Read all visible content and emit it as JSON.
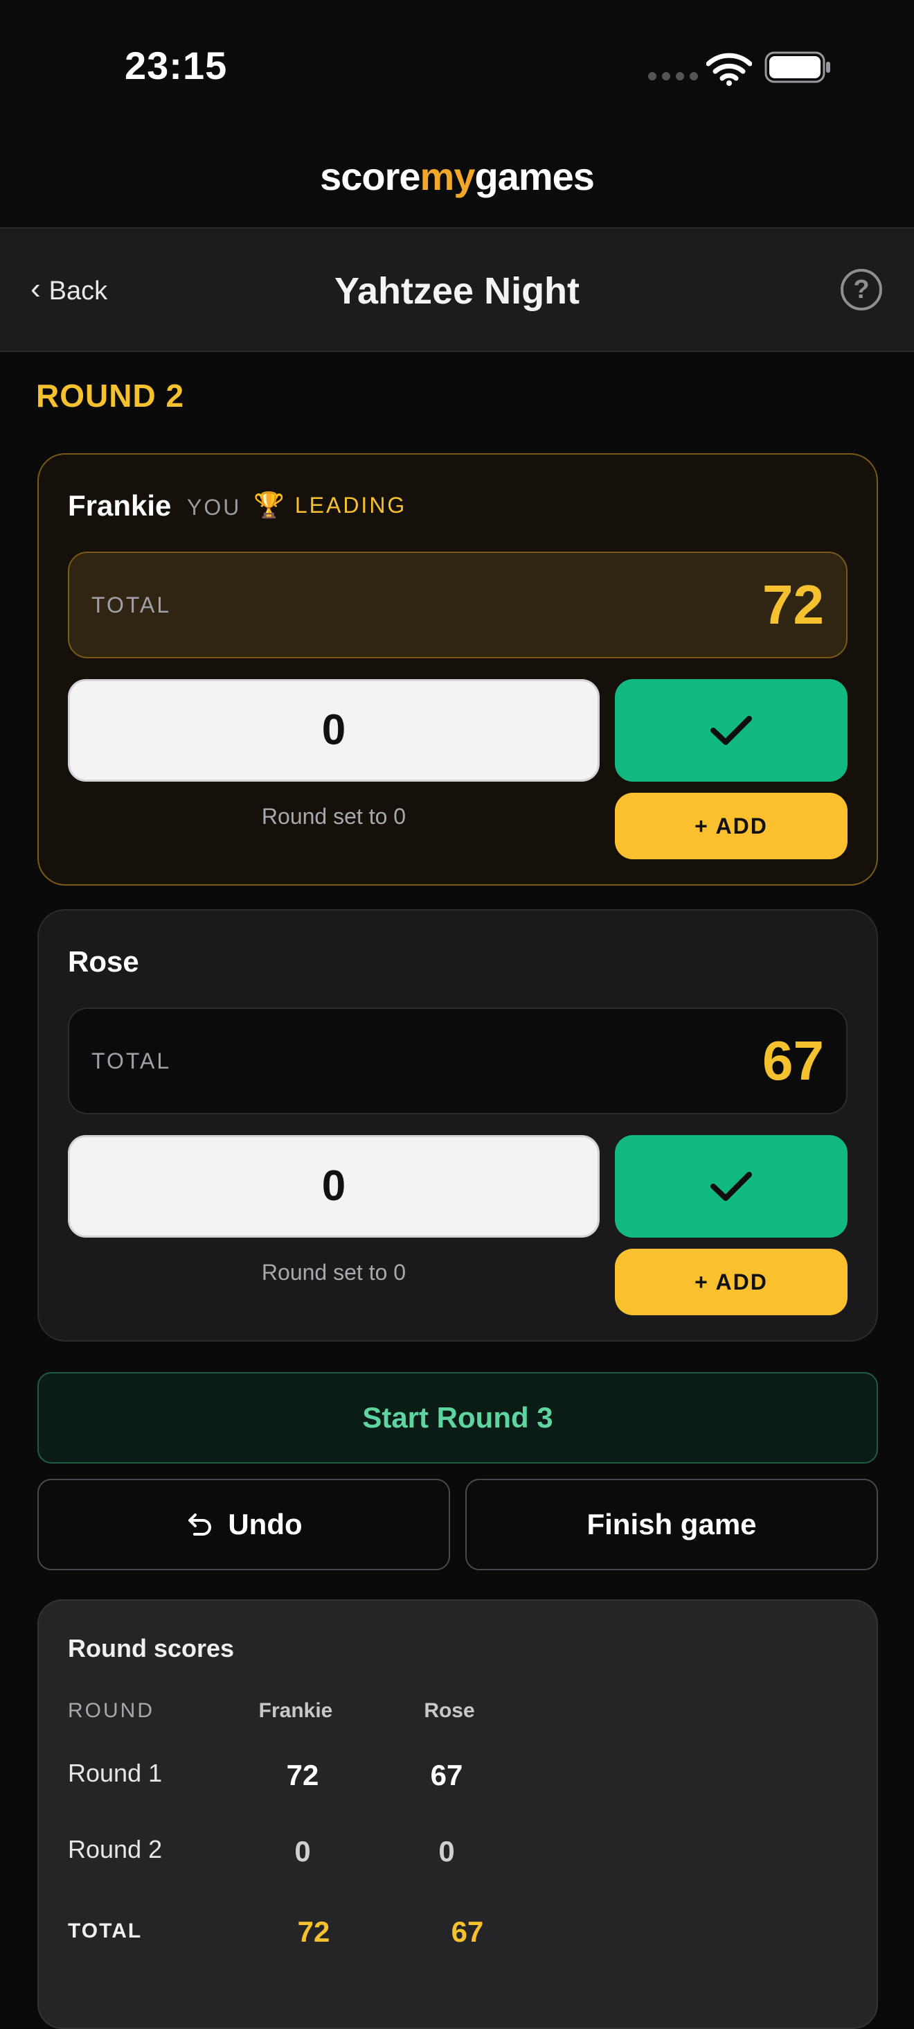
{
  "status": {
    "time": "23:15"
  },
  "brand": {
    "part1": "score",
    "part2": "my",
    "part3": "games"
  },
  "nav": {
    "back_label": "Back",
    "title": "Yahtzee Night",
    "help_label": "?"
  },
  "round": {
    "heading": "ROUND 2"
  },
  "players": [
    {
      "name": "Frankie",
      "you_tag": "YOU",
      "leading_label": "LEADING",
      "total_label": "TOTAL",
      "total": "72",
      "round_input_value": "0",
      "round_note": "Round set to 0",
      "add_label": "+ ADD"
    },
    {
      "name": "Rose",
      "total_label": "TOTAL",
      "total": "67",
      "round_input_value": "0",
      "round_note": "Round set to 0",
      "add_label": "+ ADD"
    }
  ],
  "actions": {
    "start_round": "Start Round 3",
    "undo": "Undo",
    "finish": "Finish game"
  },
  "round_scores": {
    "title": "Round scores",
    "columns": [
      "ROUND",
      "Frankie",
      "Rose"
    ],
    "rows": [
      {
        "label": "Round 1",
        "values": [
          "72",
          "67"
        ]
      },
      {
        "label": "Round 2",
        "values": [
          "0",
          "0"
        ]
      }
    ],
    "total_row": {
      "label": "TOTAL",
      "values": [
        "72",
        "67"
      ]
    }
  },
  "colors": {
    "accent_yellow": "#f6c12f",
    "confirm_green": "#12b981",
    "start_round_text": "#5ed5a1",
    "background": "#0a0a0b"
  }
}
